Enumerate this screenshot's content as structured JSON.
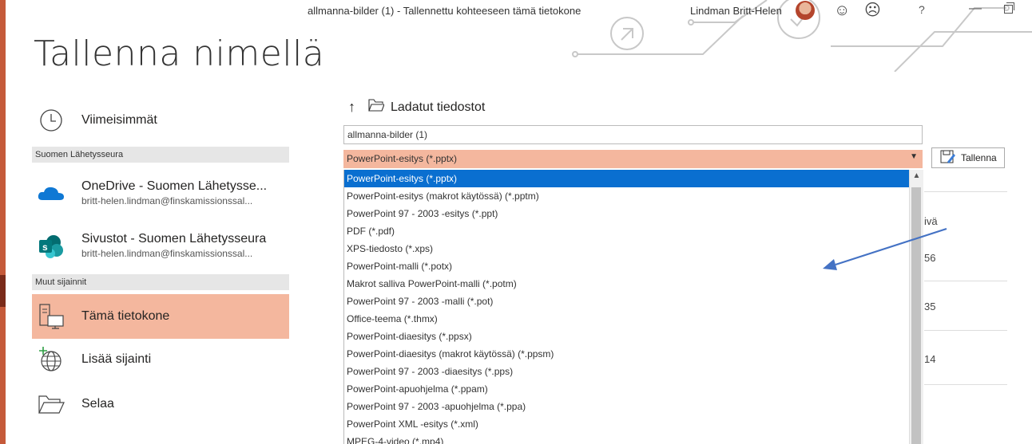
{
  "window": {
    "doc_title": "allmanna-bilder (1)  -  Tallennettu kohteeseen tämä tietokone",
    "user_name": "Lindman Britt-Helen",
    "help": "?",
    "minimize": "—"
  },
  "page_title": "Tallenna nimellä",
  "nav": {
    "recent": "Viimeisimmät",
    "section_org": "Suomen Lähetysseura",
    "onedrive": {
      "title": "OneDrive - Suomen Lähetysse...",
      "sub": "britt-helen.lindman@finskamissionssal..."
    },
    "sites": {
      "title": "Sivustot - Suomen Lähetysseura",
      "sub": "britt-helen.lindman@finskamissionssal..."
    },
    "section_other": "Muut sijainnit",
    "this_pc": "Tämä tietokone",
    "add_location": "Lisää sijainti",
    "browse": "Selaa"
  },
  "location": {
    "folder": "Ladatut tiedostot"
  },
  "filename": "allmanna-bilder (1)",
  "filetype": "PowerPoint-esitys (*.pptx)",
  "save_label": "Tallenna",
  "options": [
    "PowerPoint-esitys (*.pptx)",
    "PowerPoint-esitys (makrot käytössä) (*.pptm)",
    "PowerPoint 97 - 2003 -esitys (*.ppt)",
    "PDF (*.pdf)",
    "XPS-tiedosto (*.xps)",
    "PowerPoint-malli (*.potx)",
    "Makrot salliva PowerPoint-malli (*.potm)",
    "PowerPoint 97 - 2003 -malli (*.pot)",
    "Office-teema (*.thmx)",
    "PowerPoint-diaesitys (*.ppsx)",
    "PowerPoint-diaesitys (makrot käytössä) (*.ppsm)",
    "PowerPoint 97 - 2003 -diaesitys (*.pps)",
    "PowerPoint-apuohjelma (*.ppam)",
    "PowerPoint 97 - 2003 -apuohjelma (*.ppa)",
    "PowerPoint XML -esitys (*.xml)",
    "MPEG-4-video (*.mp4)"
  ],
  "selected_index": 0,
  "behind": {
    "header": "ivä",
    "row1": "56",
    "row2": "35",
    "row3": "14"
  },
  "colors": {
    "accent": "#c55a3a",
    "selected_bg": "#f4b79e",
    "highlight": "#0a6fd0",
    "arrow": "#4472c4"
  }
}
